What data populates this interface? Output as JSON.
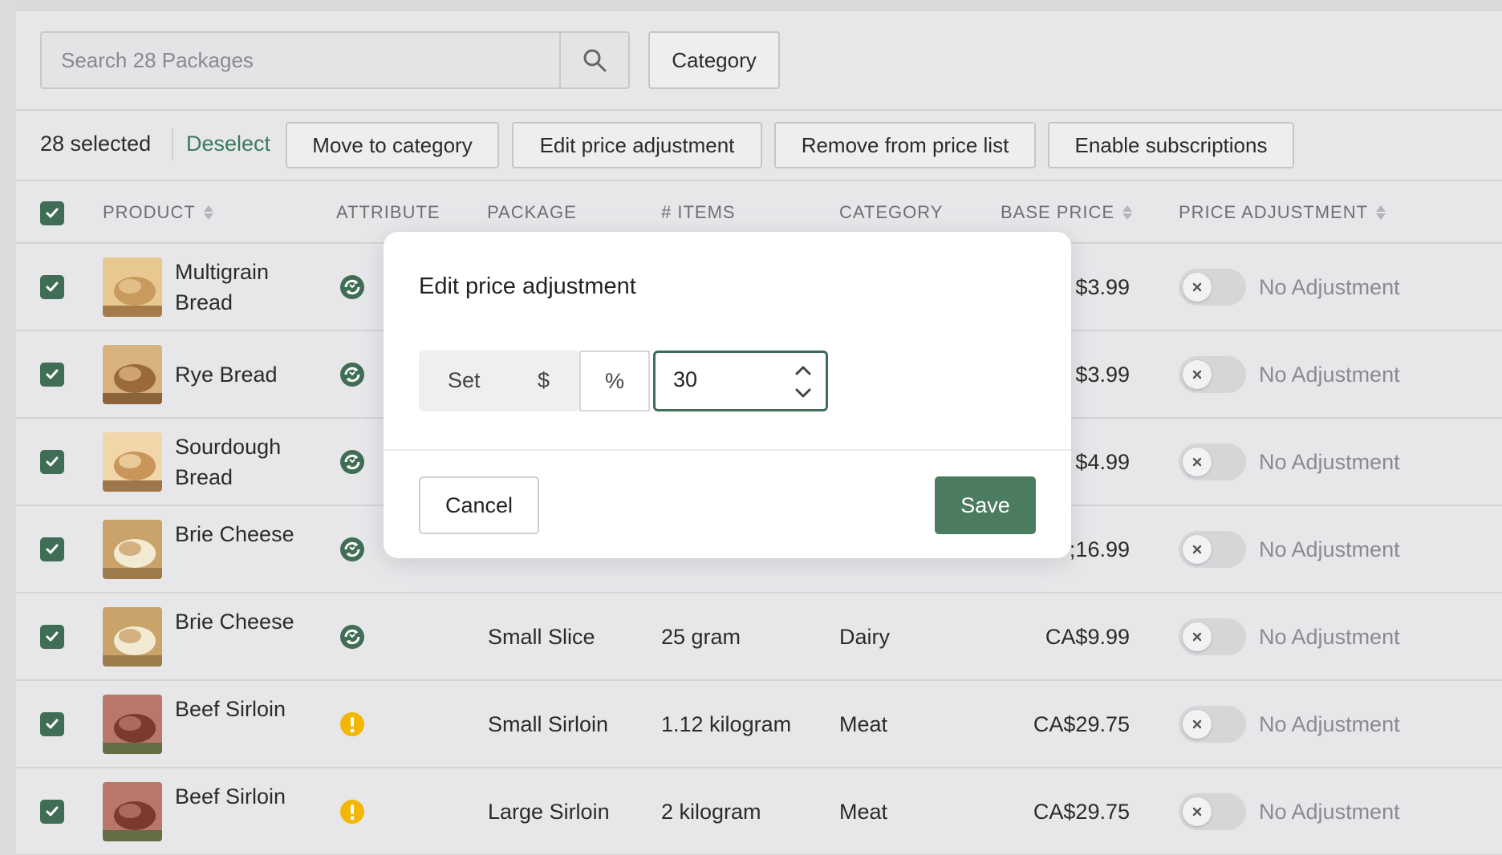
{
  "search": {
    "placeholder": "Search 28 Packages"
  },
  "filters": {
    "category_label": "Category"
  },
  "bulk": {
    "count_text": "28 selected",
    "deselect_label": "Deselect",
    "actions": [
      "Move to category",
      "Edit price adjustment",
      "Remove from price list",
      "Enable subscriptions"
    ]
  },
  "table": {
    "headers": {
      "product": "PRODUCT",
      "attribute": "ATTRIBUTE",
      "package": "PACKAGE",
      "items": "# ITEMS",
      "category": "CATEGORY",
      "base_price": "BASE PRICE",
      "price_adjustment": "PRICE ADJUSTMENT"
    },
    "rows": [
      {
        "name": "Multigrain Bread",
        "attribute_icon": "subscription-icon",
        "package": "",
        "items": "",
        "category": "",
        "base_price": "$3.99",
        "adjustment": "No Adjustment",
        "checked": true
      },
      {
        "name": "Rye Bread",
        "attribute_icon": "subscription-icon",
        "package": "",
        "items": "",
        "category": "",
        "base_price": "$3.99",
        "adjustment": "No Adjustment",
        "checked": true
      },
      {
        "name": "Sourdough Bread",
        "attribute_icon": "subscription-icon",
        "package": "",
        "items": "",
        "category": "",
        "base_price": "$4.99",
        "adjustment": "No Adjustment",
        "checked": true
      },
      {
        "name": "Brie Cheese",
        "attribute_icon": "subscription-icon",
        "package": "",
        "items": "",
        "category": "",
        "base_price": ";16.99",
        "adjustment": "No Adjustment",
        "checked": true
      },
      {
        "name": "Brie Cheese",
        "attribute_icon": "subscription-icon",
        "package": "Small Slice",
        "items": "25 gram",
        "category": "Dairy",
        "base_price": "CA$9.99",
        "adjustment": "No Adjustment",
        "checked": true
      },
      {
        "name": "Beef Sirloin",
        "attribute_icon": "warning-icon",
        "package": "Small Sirloin",
        "items": "1.12 kilogram",
        "category": "Meat",
        "base_price": "CA$29.75",
        "adjustment": "No Adjustment",
        "checked": true
      },
      {
        "name": "Beef Sirloin",
        "attribute_icon": "warning-icon",
        "package": "Large Sirloin",
        "items": "2 kilogram",
        "category": "Meat",
        "base_price": "CA$29.75",
        "adjustment": "No Adjustment",
        "checked": true
      }
    ]
  },
  "modal": {
    "title": "Edit price adjustment",
    "mode_set": "Set",
    "mode_dollar": "$",
    "mode_percent": "%",
    "value": "30",
    "cancel_label": "Cancel",
    "save_label": "Save"
  },
  "colors": {
    "accent": "#3f6d56",
    "save": "#4c7c5f",
    "link": "#3f7a5c",
    "warning": "#f2b705"
  }
}
